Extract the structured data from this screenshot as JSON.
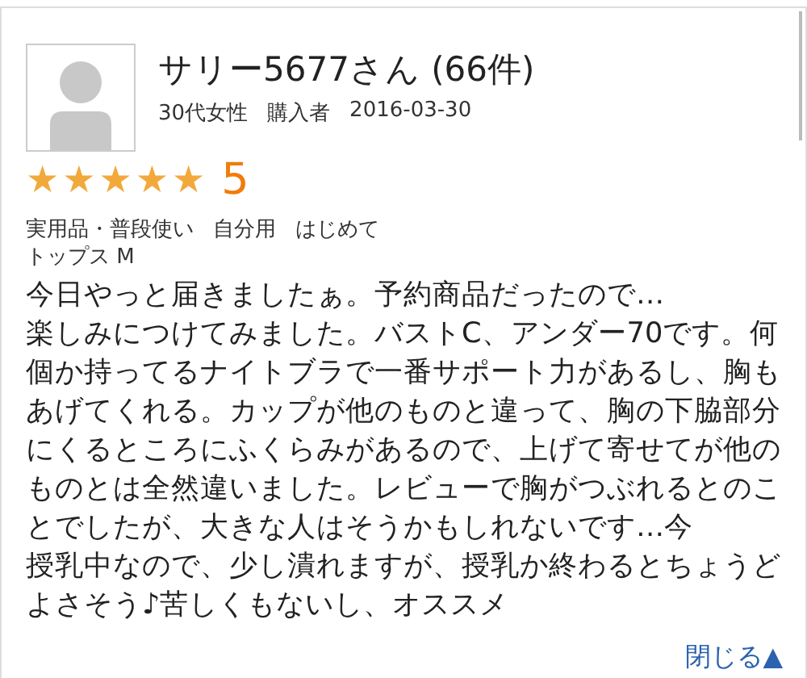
{
  "reviewer": {
    "name": "サリー5677さん (66件)",
    "age_gender": "30代女性",
    "buyer_label": "購入者",
    "date": "2016-03-30"
  },
  "rating": {
    "stars": 5,
    "score": "5"
  },
  "tags": [
    "実用品・普段使い",
    "自分用",
    "はじめて"
  ],
  "size": "トップス M",
  "body": [
    "今日やっと届きましたぁ。予約商品だったので…",
    "楽しみにつけてみました。バストC、アンダー70です。何個か持ってるナイトブラで一番サポート力があるし、胸もあげてくれる。カップが他のものと違って、胸の下脇部分にくるところにふくらみがあるので、上げて寄せてが他のものとは全然違いました。レビューで胸がつぶれるとのことでしたが、大きな人はそうかもしれないです…今",
    "授乳中なので、少し潰れますが、授乳か終わるとちょうどよさそう♪苦しくもないし、オススメ"
  ],
  "close_link": "閉じる▲"
}
